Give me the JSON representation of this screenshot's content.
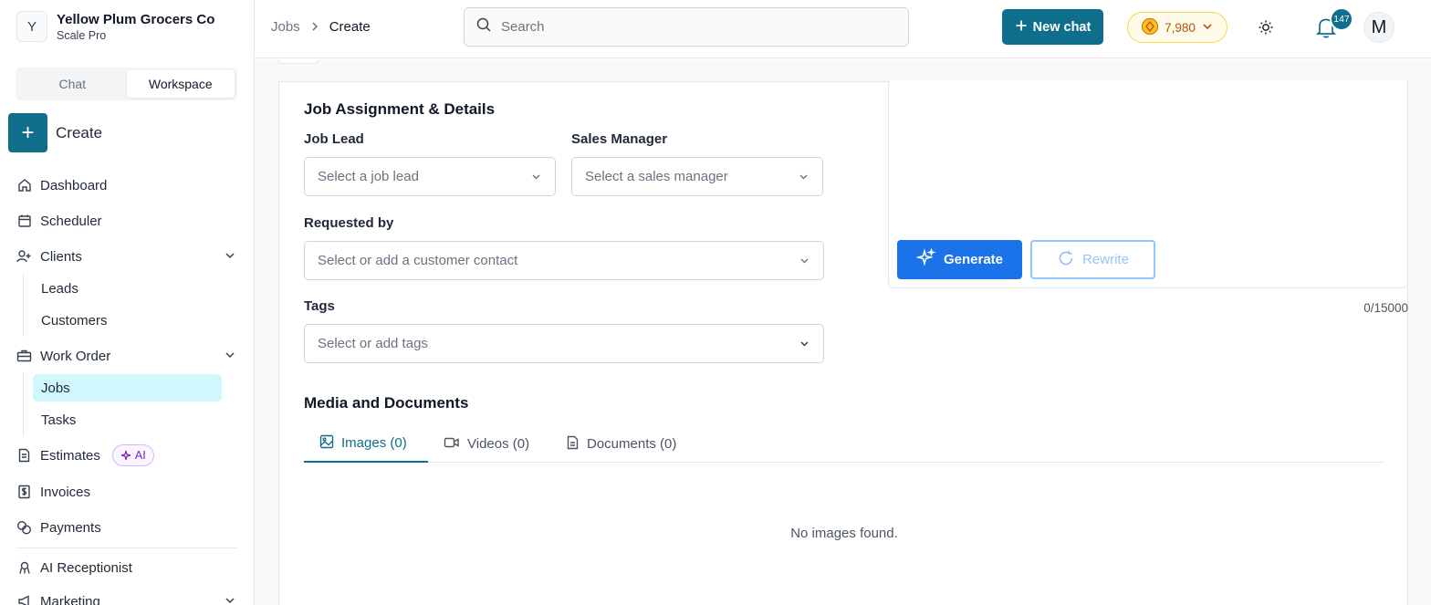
{
  "org": {
    "initial": "Y",
    "name": "Yellow Plum Grocers Co",
    "plan": "Scale Pro"
  },
  "mode_tabs": [
    {
      "label": "Chat"
    },
    {
      "label": "Workspace",
      "active": true
    }
  ],
  "create": {
    "label": "Create"
  },
  "sidebar": {
    "items": [
      {
        "label": "Dashboard",
        "icon": "home-icon"
      },
      {
        "label": "Scheduler",
        "icon": "calendar-icon"
      },
      {
        "label": "Clients",
        "icon": "user-plus-icon",
        "expanded": true,
        "children": [
          {
            "label": "Leads"
          },
          {
            "label": "Customers"
          }
        ]
      },
      {
        "label": "Work Order",
        "icon": "briefcase-icon",
        "expanded": true,
        "children": [
          {
            "label": "Jobs",
            "active": true
          },
          {
            "label": "Tasks"
          }
        ]
      },
      {
        "label": "Estimates",
        "icon": "document-icon",
        "badge": "AI"
      },
      {
        "label": "Invoices",
        "icon": "dollar-doc-icon"
      },
      {
        "label": "Payments",
        "icon": "coins-icon"
      },
      {
        "label": "AI Receptionist",
        "icon": "receptionist-icon"
      },
      {
        "label": "Marketing",
        "icon": "megaphone-icon"
      }
    ]
  },
  "header": {
    "breadcrumb": [
      "Jobs",
      "Create"
    ],
    "search_placeholder": "Search",
    "new_chat_label": "New chat",
    "credits": "7,980",
    "notification_count": "147",
    "user_initial": "M"
  },
  "form": {
    "section_title": "Job Assignment & Details",
    "job_lead": {
      "label": "Job Lead",
      "placeholder": "Select a job lead"
    },
    "sales_manager": {
      "label": "Sales Manager",
      "placeholder": "Select a sales manager"
    },
    "requested_by": {
      "label": "Requested by",
      "placeholder": "Select or add a customer contact"
    },
    "tags": {
      "label": "Tags",
      "placeholder": "Select or add tags"
    }
  },
  "ai_panel": {
    "generate_label": "Generate",
    "rewrite_label": "Rewrite",
    "char_count": "0/15000"
  },
  "media": {
    "title": "Media and Documents",
    "tabs": [
      {
        "label": "Images (0)",
        "icon": "image-icon",
        "active": true
      },
      {
        "label": "Videos (0)",
        "icon": "video-icon"
      },
      {
        "label": "Documents (0)",
        "icon": "file-icon"
      }
    ],
    "empty_message": "No images found."
  },
  "colors": {
    "primary": "#0f6e8c",
    "generate": "#1a73e8",
    "active_nav_bg": "#cff7fc"
  }
}
